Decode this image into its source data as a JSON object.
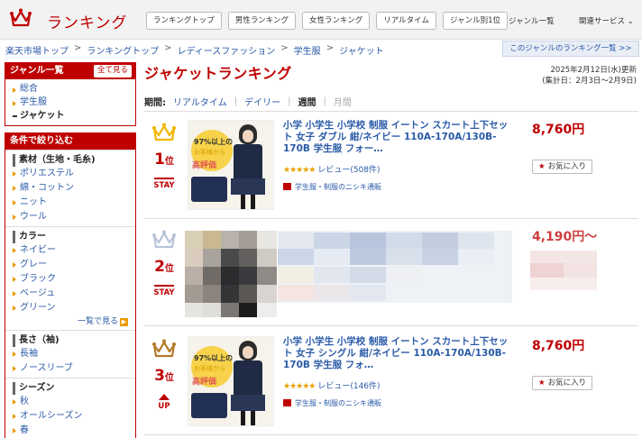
{
  "header": {
    "logo_text": "ランキング",
    "nav": [
      "ランキングトップ",
      "男性ランキング",
      "女性ランキング",
      "リアルタイム",
      "ジャンル別1位"
    ],
    "genre_list": "ジャンル一覧",
    "related": "関連サービス ⌄"
  },
  "breadcrumb": [
    "楽天市場トップ",
    "ランキングトップ",
    "レディースファッション",
    "学生服",
    "ジャケット"
  ],
  "breadcrumb_sep": ">",
  "genre_list_link": "このジャンルのランキング一覧 >>",
  "sidebar": {
    "genre_title": "ジャンル一覧",
    "see_all": "全て見る",
    "genres": [
      "総合",
      "学生服",
      "ジャケット"
    ],
    "filter_title": "条件で絞り込む",
    "filters": [
      {
        "title": "素材（生地・毛糸)",
        "items": [
          "ポリエステル",
          "綿・コットン",
          "ニット",
          "ウール"
        ]
      },
      {
        "title": "カラー",
        "items": [
          "ネイビー",
          "グレー",
          "ブラック",
          "ベージュ",
          "グリーン"
        ],
        "more": "一覧で見る"
      },
      {
        "title": "長さ（袖)",
        "items": [
          "長袖",
          "ノースリーブ"
        ]
      },
      {
        "title": "シーズン",
        "items": [
          "秋",
          "オールシーズン",
          "春"
        ]
      }
    ]
  },
  "main": {
    "title": "ジャケットランキング",
    "date_line1": "2025年2月12日(水)更新",
    "date_line2": "(集計日：2月3日～2月9日)",
    "period_label": "期間:",
    "periods": [
      "リアルタイム",
      "デイリー",
      "週間",
      "月間"
    ],
    "period_sep": "|"
  },
  "items": [
    {
      "rank": "1",
      "rank_suffix": "位",
      "move": "STAY",
      "title": "小学 小学生 小学校 制服 イートン スカート上下セット 女子 ダブル 紺/ネイビー 110A-170A/130B-170B 学生服 フォー…",
      "stars": "★★★★★",
      "review": "レビュー(508件)",
      "shop": "学生服・制服のニシキ通販",
      "price": "8,760円",
      "fav": "お気に入り",
      "thumb_t1": "97%以上の",
      "thumb_t2": "お客様から",
      "thumb_t3": "高評価"
    },
    {
      "rank": "2",
      "rank_suffix": "位",
      "move": "STAY",
      "price": "4,190円～"
    },
    {
      "rank": "3",
      "rank_suffix": "位",
      "move": "UP",
      "title": "小学 小学生 小学校 制服 イートン スカート上下セット 女子 シングル 紺/ネイビー 110A-170A/130B-170B 学生服 フォ…",
      "stars": "★★★★★",
      "review": "レビュー(146件)",
      "shop": "学生服・制服のニシキ通販",
      "price": "8,760円",
      "fav": "お気に入り",
      "thumb_t1": "97%以上の",
      "thumb_t2": "お客様から",
      "thumb_t3": "高評価"
    }
  ],
  "colors": {
    "brand": "#bf0000",
    "link": "#2a5aa8",
    "gold": "#f2b600",
    "silver": "#b8c4d6",
    "bronze": "#b57a2a"
  }
}
